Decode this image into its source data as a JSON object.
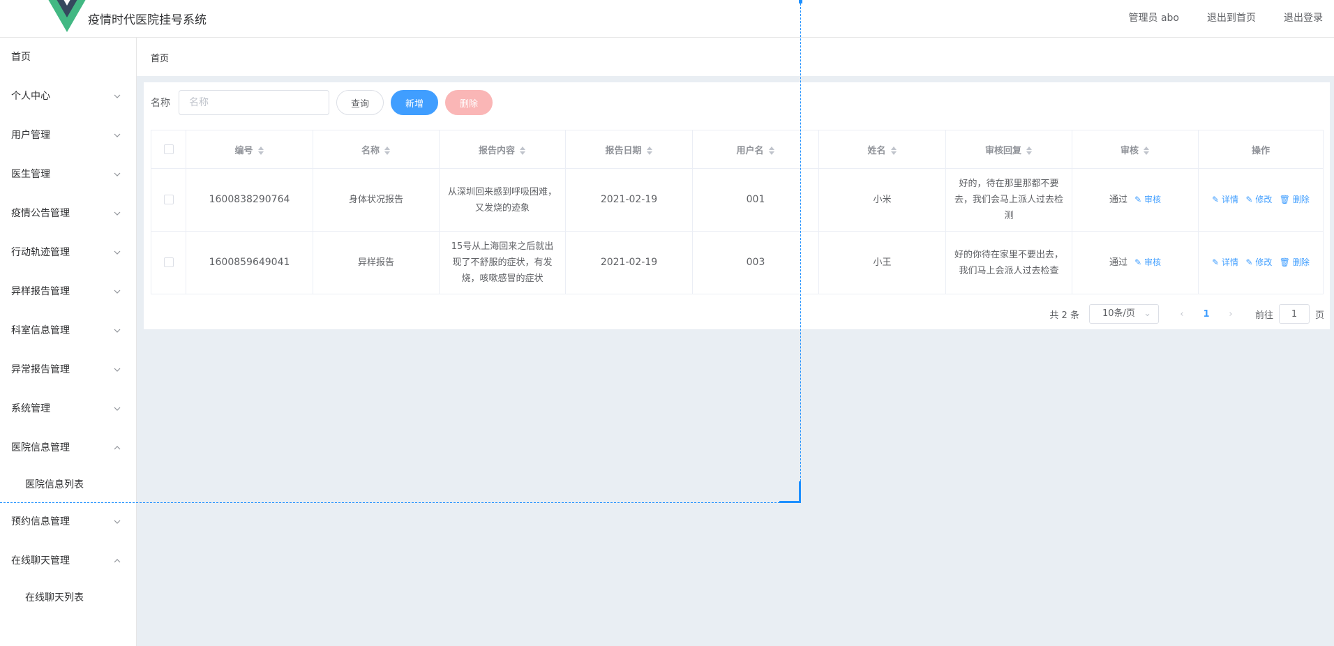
{
  "header": {
    "title": "疫情时代医院挂号系统",
    "user": "管理员 abo",
    "back_home": "退出到首页",
    "logout": "退出登录"
  },
  "sidebar": {
    "items": [
      {
        "label": "首页",
        "expandable": false
      },
      {
        "label": "个人中心",
        "expandable": true,
        "open": false
      },
      {
        "label": "用户管理",
        "expandable": true,
        "open": false
      },
      {
        "label": "医生管理",
        "expandable": true,
        "open": false
      },
      {
        "label": "疫情公告管理",
        "expandable": true,
        "open": false
      },
      {
        "label": "行动轨迹管理",
        "expandable": true,
        "open": false
      },
      {
        "label": "异样报告管理",
        "expandable": true,
        "open": false
      },
      {
        "label": "科室信息管理",
        "expandable": true,
        "open": false
      },
      {
        "label": "异常报告管理",
        "expandable": true,
        "open": false
      },
      {
        "label": "系统管理",
        "expandable": true,
        "open": false
      },
      {
        "label": "医院信息管理",
        "expandable": true,
        "open": true
      },
      {
        "label": "医院信息列表",
        "sub": true
      },
      {
        "label": "预约信息管理",
        "expandable": true,
        "open": false
      },
      {
        "label": "在线聊天管理",
        "expandable": true,
        "open": true
      },
      {
        "label": "在线聊天列表",
        "sub": true
      }
    ]
  },
  "breadcrumb": "首页",
  "search": {
    "label": "名称",
    "placeholder": "名称",
    "query_btn": "查询",
    "add_btn": "新增",
    "delete_btn": "删除"
  },
  "table": {
    "headers": [
      "编号",
      "名称",
      "报告内容",
      "报告日期",
      "用户名",
      "姓名",
      "审核回复",
      "审核",
      "操作"
    ],
    "rows": [
      {
        "id": "1600838290764",
        "name": "身体状况报告",
        "content": "从深圳回来感到呼吸困难，又发烧的迹象",
        "date": "2021-02-19",
        "username": "001",
        "realname": "小米",
        "reply": "好的，待在那里那都不要去，我们会马上派人过去检测",
        "status": "通过",
        "audit_link": "审核",
        "detail": "详情",
        "edit": "修改",
        "delete": "删除"
      },
      {
        "id": "1600859649041",
        "name": "异样报告",
        "content": "15号从上海回来之后就出现了不舒服的症状，有发烧，咳嗽感冒的症状",
        "date": "2021-02-19",
        "username": "003",
        "realname": "小王",
        "reply": "好的你待在家里不要出去，我们马上会派人过去检查",
        "status": "通过",
        "audit_link": "审核",
        "detail": "详情",
        "edit": "修改",
        "delete": "删除"
      }
    ]
  },
  "pagination": {
    "total": "共 2 条",
    "page_size": "10条/页",
    "current": "1",
    "goto_prefix": "前往",
    "goto_value": "1",
    "goto_suffix": "页"
  },
  "colors": {
    "primary": "#409eff",
    "danger_disabled": "#fab6b6",
    "logo_green": "#42b883",
    "logo_dark": "#35495e"
  }
}
